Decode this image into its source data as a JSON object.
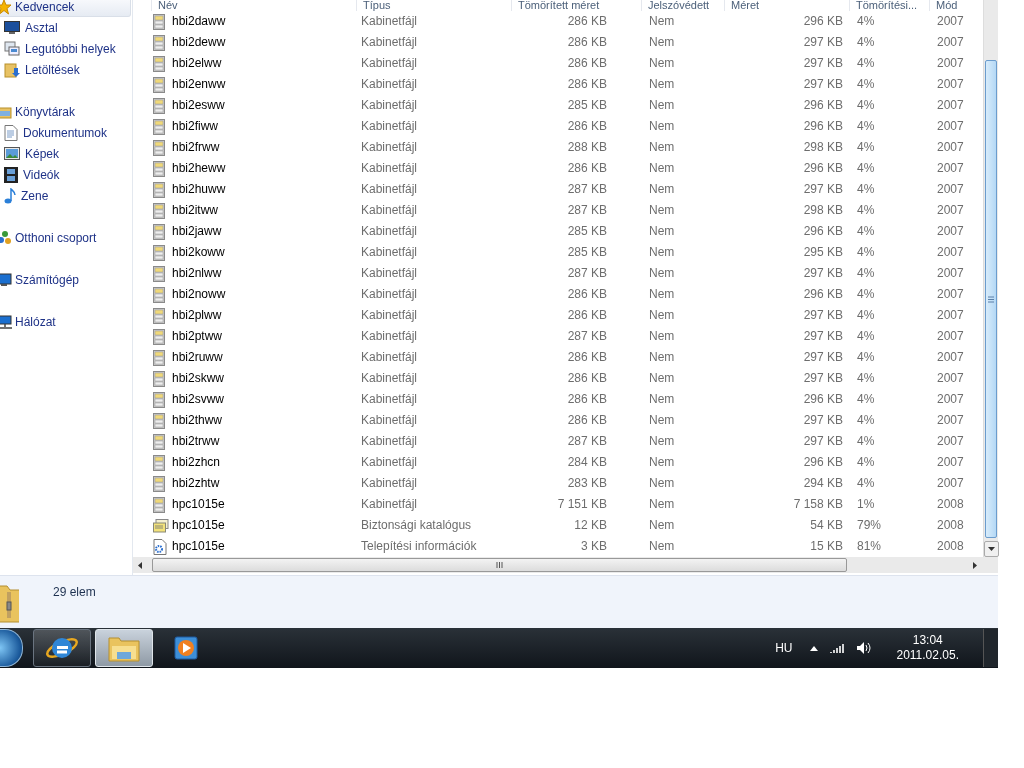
{
  "sidebar": [
    {
      "label": "Kedvencek",
      "kind": "star",
      "selected": true,
      "children": [
        {
          "label": "Asztal",
          "kind": "desktop",
          "selected": false
        },
        {
          "label": "Legutóbbi helyek",
          "kind": "recent",
          "selected": false
        },
        {
          "label": "Letöltések",
          "kind": "download",
          "selected": false
        }
      ]
    },
    {
      "label": "Könyvtárak",
      "kind": "library",
      "selected": false,
      "children": [
        {
          "label": "Dokumentumok",
          "kind": "document",
          "selected": false
        },
        {
          "label": "Képek",
          "kind": "picture",
          "selected": false
        },
        {
          "label": "Videók",
          "kind": "film",
          "selected": false
        },
        {
          "label": "Zene",
          "kind": "music",
          "selected": false
        }
      ]
    },
    {
      "label": "Otthoni csoport",
      "kind": "homegroup",
      "selected": false
    },
    {
      "label": "Számítógép",
      "kind": "computer",
      "selected": false
    },
    {
      "label": "Hálózat",
      "kind": "network",
      "selected": false
    }
  ],
  "table": {
    "columns": [
      "Név",
      "Típus",
      "Tömörített méret",
      "Jelszóvédett",
      "Méret",
      "Tömörítési...",
      "Mód"
    ],
    "rows": [
      {
        "kind": "cabinet",
        "name": "hbi2daww",
        "type": "Kabinetfájl",
        "compressed": "286 KB",
        "protected": "Nem",
        "size": "296 KB",
        "ratio": "4%",
        "modified": "2007"
      },
      {
        "kind": "cabinet",
        "name": "hbi2deww",
        "type": "Kabinetfájl",
        "compressed": "286 KB",
        "protected": "Nem",
        "size": "297 KB",
        "ratio": "4%",
        "modified": "2007"
      },
      {
        "kind": "cabinet",
        "name": "hbi2elww",
        "type": "Kabinetfájl",
        "compressed": "286 KB",
        "protected": "Nem",
        "size": "297 KB",
        "ratio": "4%",
        "modified": "2007"
      },
      {
        "kind": "cabinet",
        "name": "hbi2enww",
        "type": "Kabinetfájl",
        "compressed": "286 KB",
        "protected": "Nem",
        "size": "297 KB",
        "ratio": "4%",
        "modified": "2007"
      },
      {
        "kind": "cabinet",
        "name": "hbi2esww",
        "type": "Kabinetfájl",
        "compressed": "285 KB",
        "protected": "Nem",
        "size": "296 KB",
        "ratio": "4%",
        "modified": "2007"
      },
      {
        "kind": "cabinet",
        "name": "hbi2fiww",
        "type": "Kabinetfájl",
        "compressed": "286 KB",
        "protected": "Nem",
        "size": "296 KB",
        "ratio": "4%",
        "modified": "2007"
      },
      {
        "kind": "cabinet",
        "name": "hbi2frww",
        "type": "Kabinetfájl",
        "compressed": "288 KB",
        "protected": "Nem",
        "size": "298 KB",
        "ratio": "4%",
        "modified": "2007"
      },
      {
        "kind": "cabinet",
        "name": "hbi2heww",
        "type": "Kabinetfájl",
        "compressed": "286 KB",
        "protected": "Nem",
        "size": "296 KB",
        "ratio": "4%",
        "modified": "2007"
      },
      {
        "kind": "cabinet",
        "name": "hbi2huww",
        "type": "Kabinetfájl",
        "compressed": "287 KB",
        "protected": "Nem",
        "size": "297 KB",
        "ratio": "4%",
        "modified": "2007"
      },
      {
        "kind": "cabinet",
        "name": "hbi2itww",
        "type": "Kabinetfájl",
        "compressed": "287 KB",
        "protected": "Nem",
        "size": "298 KB",
        "ratio": "4%",
        "modified": "2007"
      },
      {
        "kind": "cabinet",
        "name": "hbi2jaww",
        "type": "Kabinetfájl",
        "compressed": "285 KB",
        "protected": "Nem",
        "size": "296 KB",
        "ratio": "4%",
        "modified": "2007"
      },
      {
        "kind": "cabinet",
        "name": "hbi2koww",
        "type": "Kabinetfájl",
        "compressed": "285 KB",
        "protected": "Nem",
        "size": "295 KB",
        "ratio": "4%",
        "modified": "2007"
      },
      {
        "kind": "cabinet",
        "name": "hbi2nlww",
        "type": "Kabinetfájl",
        "compressed": "287 KB",
        "protected": "Nem",
        "size": "297 KB",
        "ratio": "4%",
        "modified": "2007"
      },
      {
        "kind": "cabinet",
        "name": "hbi2noww",
        "type": "Kabinetfájl",
        "compressed": "286 KB",
        "protected": "Nem",
        "size": "296 KB",
        "ratio": "4%",
        "modified": "2007"
      },
      {
        "kind": "cabinet",
        "name": "hbi2plww",
        "type": "Kabinetfájl",
        "compressed": "286 KB",
        "protected": "Nem",
        "size": "297 KB",
        "ratio": "4%",
        "modified": "2007"
      },
      {
        "kind": "cabinet",
        "name": "hbi2ptww",
        "type": "Kabinetfájl",
        "compressed": "287 KB",
        "protected": "Nem",
        "size": "297 KB",
        "ratio": "4%",
        "modified": "2007"
      },
      {
        "kind": "cabinet",
        "name": "hbi2ruww",
        "type": "Kabinetfájl",
        "compressed": "286 KB",
        "protected": "Nem",
        "size": "297 KB",
        "ratio": "4%",
        "modified": "2007"
      },
      {
        "kind": "cabinet",
        "name": "hbi2skww",
        "type": "Kabinetfájl",
        "compressed": "286 KB",
        "protected": "Nem",
        "size": "297 KB",
        "ratio": "4%",
        "modified": "2007"
      },
      {
        "kind": "cabinet",
        "name": "hbi2svww",
        "type": "Kabinetfájl",
        "compressed": "286 KB",
        "protected": "Nem",
        "size": "296 KB",
        "ratio": "4%",
        "modified": "2007"
      },
      {
        "kind": "cabinet",
        "name": "hbi2thww",
        "type": "Kabinetfájl",
        "compressed": "286 KB",
        "protected": "Nem",
        "size": "297 KB",
        "ratio": "4%",
        "modified": "2007"
      },
      {
        "kind": "cabinet",
        "name": "hbi2trww",
        "type": "Kabinetfájl",
        "compressed": "287 KB",
        "protected": "Nem",
        "size": "297 KB",
        "ratio": "4%",
        "modified": "2007"
      },
      {
        "kind": "cabinet",
        "name": "hbi2zhcn",
        "type": "Kabinetfájl",
        "compressed": "284 KB",
        "protected": "Nem",
        "size": "296 KB",
        "ratio": "4%",
        "modified": "2007"
      },
      {
        "kind": "cabinet",
        "name": "hbi2zhtw",
        "type": "Kabinetfájl",
        "compressed": "283 KB",
        "protected": "Nem",
        "size": "294 KB",
        "ratio": "4%",
        "modified": "2007"
      },
      {
        "kind": "cabinet",
        "name": "hpc1015e",
        "type": "Kabinetfájl",
        "compressed": "7 151 KB",
        "protected": "Nem",
        "size": "7 158 KB",
        "ratio": "1%",
        "modified": "2008"
      },
      {
        "kind": "catalog",
        "name": "hpc1015e",
        "type": "Biztonsági katalógus",
        "compressed": "12 KB",
        "protected": "Nem",
        "size": "54 KB",
        "ratio": "79%",
        "modified": "2008"
      },
      {
        "kind": "setup",
        "name": "hpc1015e",
        "type": "Telepítési információk",
        "compressed": "3 KB",
        "protected": "Nem",
        "size": "15 KB",
        "ratio": "81%",
        "modified": "2008"
      }
    ]
  },
  "status_bar": {
    "count": "29 elem"
  },
  "taskbar": {
    "buttons": [
      {
        "kind": "browser",
        "running": true,
        "selected": false
      },
      {
        "kind": "explorer",
        "running": true,
        "selected": true
      },
      {
        "kind": "media",
        "running": false,
        "selected": false
      }
    ],
    "language": "HU",
    "time": "13:04",
    "date": "2011.02.05."
  }
}
